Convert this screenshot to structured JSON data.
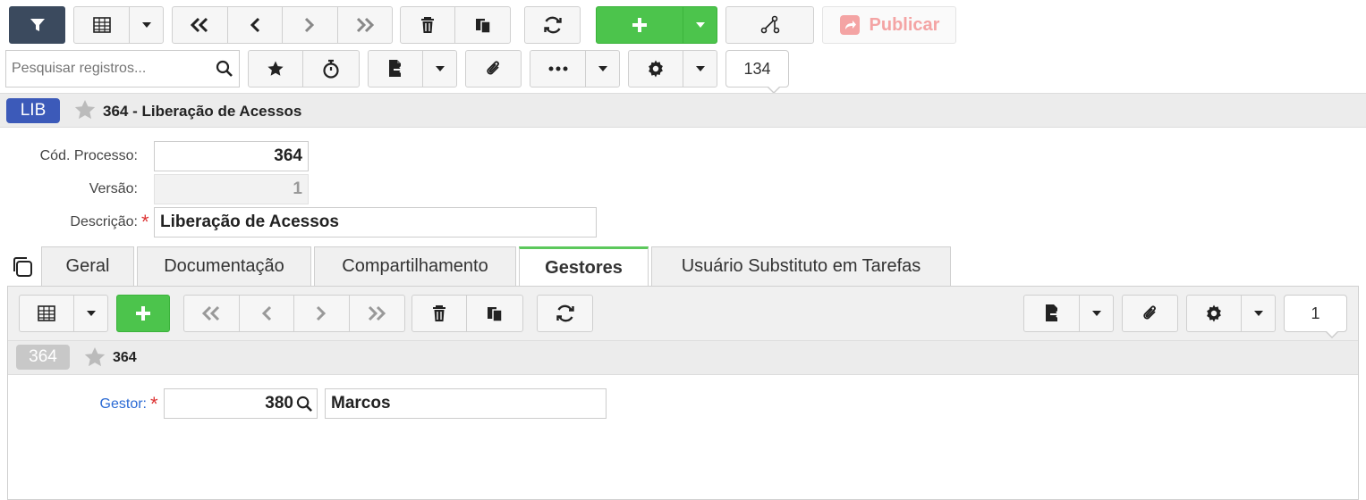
{
  "toolbar": {
    "search_placeholder": "Pesquisar registros...",
    "publish_label": "Publicar",
    "record_count": "134"
  },
  "header": {
    "badge": "LIB",
    "title": "364 - Liberação de Acessos"
  },
  "form": {
    "cod_processo_label": "Cód. Processo:",
    "cod_processo_value": "364",
    "versao_label": "Versão:",
    "versao_value": "1",
    "descricao_label": "Descrição:",
    "descricao_value": "Liberação de Acessos",
    "required_mark": "*"
  },
  "tabs": [
    {
      "label": "Geral"
    },
    {
      "label": "Documentação"
    },
    {
      "label": "Compartilhamento"
    },
    {
      "label": "Gestores"
    },
    {
      "label": "Usuário Substituto em Tarefas"
    }
  ],
  "sub": {
    "record_count": "1",
    "badge": "364",
    "title": "364",
    "gestor_label": "Gestor:",
    "gestor_code": "380",
    "gestor_name": "Marcos"
  },
  "colors": {
    "accent_green": "#4cc44c",
    "badge_blue": "#3c5ab9",
    "publish_red": "#f4a4a4",
    "active_tab": "#5cc85c",
    "link_blue": "#2a6ad4"
  }
}
